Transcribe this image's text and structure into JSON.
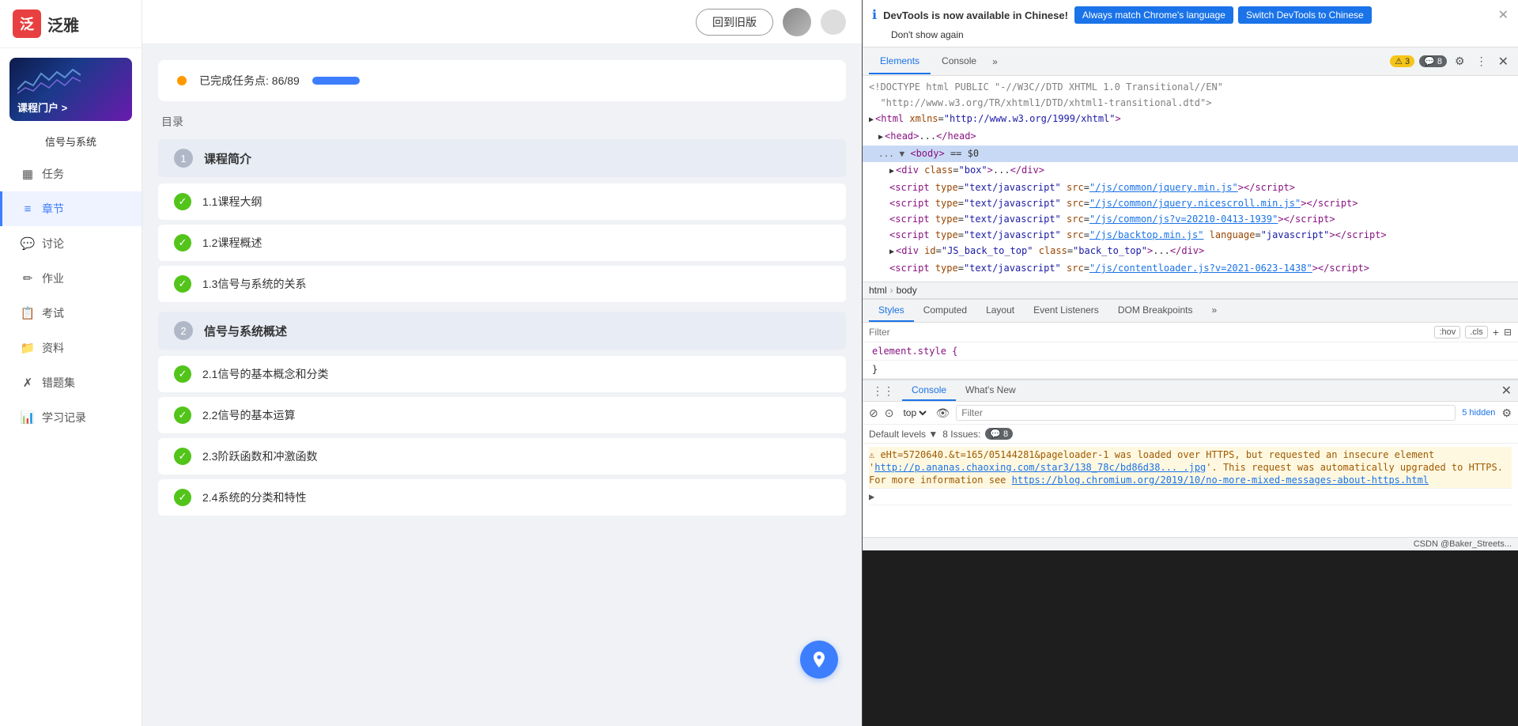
{
  "app": {
    "logo_char": "泛",
    "logo_text": "泛雅"
  },
  "sidebar": {
    "course_title": "信号与系统",
    "nav_items": [
      {
        "id": "tasks",
        "label": "任务",
        "icon": "▦"
      },
      {
        "id": "chapters",
        "label": "章节",
        "icon": "≡",
        "active": true
      },
      {
        "id": "discussion",
        "label": "讨论",
        "icon": "💬"
      },
      {
        "id": "homework",
        "label": "作业",
        "icon": "✏"
      },
      {
        "id": "exam",
        "label": "考试",
        "icon": "📋"
      },
      {
        "id": "resources",
        "label": "资料",
        "icon": "📁"
      },
      {
        "id": "mistakes",
        "label": "错题集",
        "icon": "✗"
      },
      {
        "id": "records",
        "label": "学习记录",
        "icon": "📊"
      }
    ],
    "banner_caption": "课程门户 >"
  },
  "topbar": {
    "back_btn": "回到旧版"
  },
  "content": {
    "progress_label": "已完成任务点: 86/89",
    "toc_label": "目录",
    "chapters": [
      {
        "num": "1",
        "title": "课程简介",
        "lessons": [
          {
            "id": "1.1",
            "title": "1.1课程大纲",
            "done": true
          },
          {
            "id": "1.2",
            "title": "1.2课程概述",
            "done": true
          },
          {
            "id": "1.3",
            "title": "1.3信号与系统的关系",
            "done": true
          }
        ]
      },
      {
        "num": "2",
        "title": "信号与系统概述",
        "lessons": [
          {
            "id": "2.1",
            "title": "2.1信号的基本概念和分类",
            "done": true
          },
          {
            "id": "2.2",
            "title": "2.2信号的基本运算",
            "done": true
          },
          {
            "id": "2.3",
            "title": "2.3阶跃函数和冲激函数",
            "done": true
          },
          {
            "id": "2.4",
            "title": "2.4系统的分类和特性",
            "done": true
          }
        ]
      }
    ]
  },
  "devtools": {
    "notification": {
      "info_icon": "ℹ",
      "title": "DevTools is now available in Chinese!",
      "btn1": "Always match Chrome's language",
      "btn2": "Switch DevTools to Chinese",
      "dont_show": "Don't show again"
    },
    "tabs": [
      "Elements",
      "Console",
      "»"
    ],
    "active_tab": "Elements",
    "warn_count": "3",
    "msg_count": "8",
    "elements_content": [
      {
        "indent": 0,
        "html": "<!DOCTYPE html PUBLIC \"-//W3C//DTD XHTML 1.0 Transitional//EN\""
      },
      {
        "indent": 0,
        "html": "\"http://www.w3.org/TR/xhtml1/DTD/xhtml1-transitional.dtd\">"
      },
      {
        "indent": 0,
        "tag": "html",
        "attrs": "xmlns=\"http://www.w3.org/1999/xhtml\""
      },
      {
        "indent": 1,
        "tag": "head",
        "collapsed": true
      },
      {
        "indent": 1,
        "tag": "body",
        "selected": true,
        "dollar": "== $0"
      }
    ],
    "body_children": [
      {
        "indent": 2,
        "tag": "div",
        "attrs": "class=\"box\"",
        "collapsed": true
      },
      {
        "indent": 2,
        "tag": "script",
        "attrs": "type=\"text/javascript\" src=\"/js/common/jquery.min.js\""
      },
      {
        "indent": 2,
        "tag": "script",
        "attrs": "type=\"text/javascript\" src=\"/js/common/jquery.nicescroll.min.js\""
      },
      {
        "indent": 2,
        "tag": "script",
        "attrs": "type=\"text/javascript\" src=\"/js/common/js?v=20210-0413-1939\"",
        "link": "/js/common/js?v=20210-0413-1939"
      },
      {
        "indent": 2,
        "tag": "script",
        "attrs": "type=\"text/javascript\" src=\"/js/backtop.min.js\" language=\"javascript\"",
        "link": "/js/backtop.min.js"
      },
      {
        "indent": 2,
        "tag": "div",
        "attrs": "id=\"JS_back_to_top\" class=\"back_to_top\"",
        "collapsed": true
      },
      {
        "indent": 2,
        "tag": "script",
        "attrs": "type=\"text/javascript\" src=\"/js/contentloader.js?v=2021-0623-1438\"",
        "link": "/js/contentloader.js?v=2021-0623-1438"
      }
    ],
    "breadcrumb": [
      "html",
      "body"
    ],
    "styles_tabs": [
      "Styles",
      "Computed",
      "Layout",
      "Event Listeners",
      "DOM Breakpoints",
      "»"
    ],
    "active_styles_tab": "Styles",
    "filter_placeholder": "Filter",
    "filter_hov": ":hov",
    "filter_cls": ".cls",
    "style_rules": [
      {
        "selector": "element.style {",
        "props": []
      },
      {
        "selector": "}",
        "props": []
      }
    ],
    "console": {
      "tabs": [
        "Console",
        "What's New"
      ],
      "active_tab": "Console",
      "toolbar_top": "top",
      "filter_placeholder": "Filter",
      "hidden_count": "5 hidden",
      "levels_label": "Default levels",
      "issues_count": "8 Issues:",
      "issues_badge": "8",
      "messages": [
        {
          "type": "warn",
          "text": "eHt=5720640.&t=165/05144281&pageloader-1 was loaded over HTTPS, but requested an insecure element 'http://p.ananas.chaoxing.com/star3/138_78c/bd86d38... .jpg'. This request was automatically upgraded to HTTPS. For more information see https://blog.chromium.org/2019/10/no-more-mixed-messages-about-https.html"
        }
      ]
    }
  },
  "statusbar": {
    "text": "CSDN @Baker_Streets..."
  }
}
